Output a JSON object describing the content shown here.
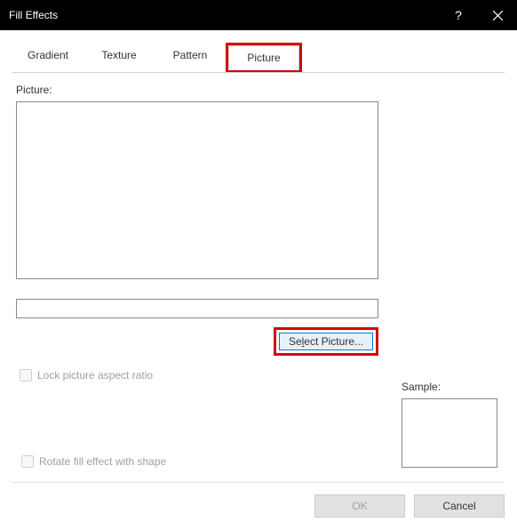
{
  "window": {
    "title": "Fill Effects"
  },
  "tabs": {
    "gradient": "Gradient",
    "texture": "Texture",
    "pattern": "Pattern",
    "picture": "Picture"
  },
  "panel": {
    "picture_label": "Picture:",
    "path_value": "",
    "select_button": "Select Picture...",
    "lock_aspect": "Lock picture aspect ratio",
    "sample_label": "Sample:",
    "rotate_label": "Rotate fill effect with shape"
  },
  "buttons": {
    "ok": "OK",
    "cancel": "Cancel"
  }
}
